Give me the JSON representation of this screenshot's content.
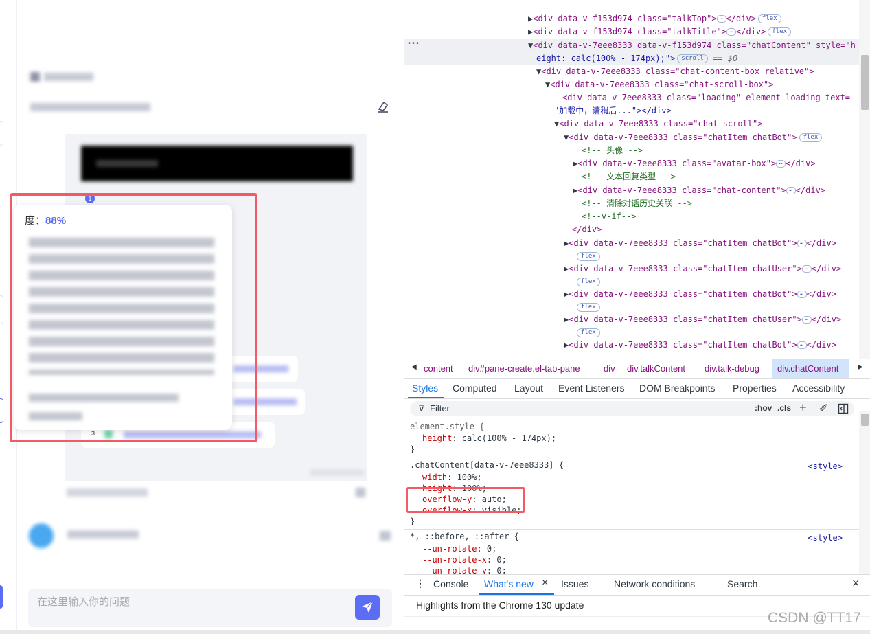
{
  "chat": {
    "tooltip_label": "度：",
    "tooltip_value": "88%",
    "badge_1": "1",
    "badge_3": "3",
    "input_placeholder": "在这里输入你的问题"
  },
  "elements": {
    "lines": [
      {
        "indent": 0,
        "arrow": "▶",
        "html": "talkTop"
      },
      {
        "indent": 0,
        "arrow": "▶",
        "html": "talkTitle"
      }
    ],
    "ellipsis": "•••",
    "selected_line_1": "<div data-v-7eee8333 data-v-f153d974 class=\"chatContent\" style=\"h",
    "selected_line_2": "eight: calc(100% - 174px);\">",
    "selected_scroll_pill": "scroll",
    "selected_suffix": "== $0",
    "line_talkTop": "<div data-v-f153d974 class=\"talkTop\">",
    "line_talkTitle": "<div data-v-f153d974 class=\"talkTitle\">",
    "line_chatContentBox": "<div data-v-7eee8333 class=\"chat-content-box relative\">",
    "line_chatScrollBox": "<div data-v-7eee8333 class=\"chat-scroll-box\">",
    "line_loading_1": "<div data-v-7eee8333 class=\"loading\" element-loading-text=",
    "line_loading_2": "\"加载中，请稍后...\"></div>",
    "line_chatScroll": "<div data-v-7eee8333 class=\"chat-scroll\">",
    "line_chatItemBot": "<div data-v-7eee8333 class=\"chatItem chatBot\">",
    "comment_avatar": "<!-- 头像 -->",
    "line_avatarBox": "<div data-v-7eee8333 class=\"avatar-box\">",
    "comment_text": "<!-- 文本回复类型 -->",
    "line_chatContent": "<div data-v-7eee8333 class=\"chat-content\">",
    "comment_clear": "<!-- 清除对话历史关联 -->",
    "comment_vif": "<!--v-if-->",
    "close_div": "</div>",
    "end_div": "</div>",
    "flex": "flex",
    "items": [
      "<div data-v-7eee8333 class=\"chatItem chatBot\">",
      "<div data-v-7eee8333 class=\"chatItem chatUser\">",
      "<div data-v-7eee8333 class=\"chatItem chatBot\">",
      "<div data-v-7eee8333 class=\"chatItem chatUser\">",
      "<div data-v-7eee8333 class=\"chatItem chatBot\">"
    ]
  },
  "breadcrumb": [
    "content",
    "div#pane-create.el-tab-pane",
    "div",
    "div.talkContent",
    "div.talk-debug",
    "div.chatContent"
  ],
  "tabs": [
    "Styles",
    "Computed",
    "Layout",
    "Event Listeners",
    "DOM Breakpoints",
    "Properties",
    "Accessibility"
  ],
  "filter": {
    "placeholder": "Filter",
    "hov": ":hov",
    "cls": ".cls"
  },
  "styles": {
    "element_style": "element.style {",
    "height_prop": "height",
    "height_val": ": calc(100% - 174px);",
    "close": "}",
    "rule_selector": ".chatContent[data-v-7eee8333] {",
    "width_prop": "width",
    "width_val": ": 100%;",
    "height2_prop": "height",
    "height2_val": ": 100%;",
    "overflow_y_prop": "overflow-y",
    "overflow_y_val": ": auto;",
    "overflow_x_prop": "overflow-x",
    "overflow_x_val": ": visible;",
    "source": "<style>",
    "universal_selector": "*, ::before, ::after {",
    "vars": [
      {
        "prop": "--un-rotate",
        "val": ": 0;"
      },
      {
        "prop": "--un-rotate-x",
        "val": ": 0;"
      },
      {
        "prop": "--un-rotate-y",
        "val": ": 0;"
      }
    ]
  },
  "drawer": {
    "tabs": [
      "Console",
      "What's new",
      "Issues",
      "Network conditions",
      "Search"
    ],
    "close": "×",
    "content": "Highlights from the Chrome 130 update"
  },
  "watermark": "CSDN @TT17",
  "colors": {
    "accent": "#1a73e8",
    "highlight_red": "#f25a66",
    "send_button": "#5b6cf5",
    "tooltip_value": "#5b6cf5"
  }
}
